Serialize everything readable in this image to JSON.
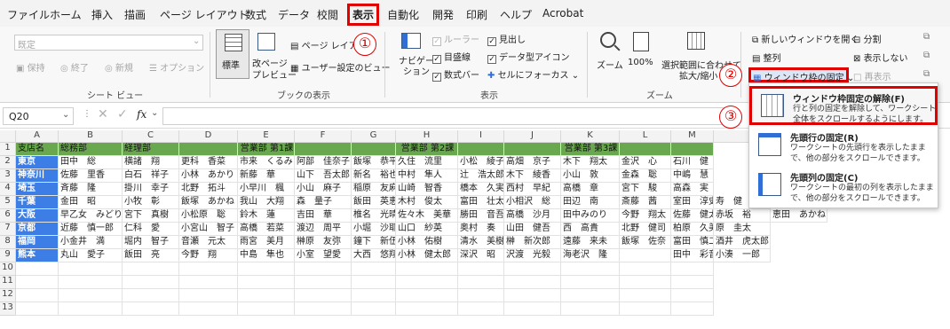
{
  "menu": [
    "ファイル",
    "ホーム",
    "挿入",
    "描画",
    "ページ レイアウト",
    "数式",
    "データ",
    "校閲",
    "表示",
    "自動化",
    "開発",
    "印刷",
    "ヘルプ",
    "Acrobat"
  ],
  "ribbon": {
    "sheet_view": {
      "select_placeholder": "既定",
      "keep": "保持",
      "exit": "終了",
      "new": "新規",
      "options": "オプション",
      "label": "シート ビュー"
    },
    "workbook_views": {
      "normal": "標準",
      "page_break": "改ページ",
      "page_break2": "プレビュー",
      "page_layout": "ページ レイアウト",
      "custom": "ユーザー設定のビュー",
      "label": "ブックの表示"
    },
    "show": {
      "navigation": "ナビゲー",
      "navigation2": "ション",
      "ruler": "ルーラー",
      "gridlines": "目盛線",
      "formula_bar": "数式バー",
      "headings": "見出し",
      "data_icons": "データ型アイコン",
      "focus_cell": "セルにフォーカス",
      "label": "表示"
    },
    "zoom": {
      "zoom": "ズーム",
      "hundred": "100%",
      "selection": "選択範囲に合わせて",
      "selection2": "拡大/縮小",
      "label": "ズーム"
    },
    "window": {
      "new_window": "新しいウィンドウを開く",
      "arrange": "整列",
      "freeze": "ウィンドウ枠の固定",
      "split": "分割",
      "hide": "表示しない",
      "unhide": "再表示"
    }
  },
  "callouts": [
    "①",
    "②",
    "③"
  ],
  "formula_bar": {
    "name_box": "Q20",
    "fx": "fx"
  },
  "columns": [
    "A",
    "B",
    "C",
    "D",
    "E",
    "F",
    "G",
    "H",
    "I",
    "J",
    "K",
    "L",
    "M"
  ],
  "rows": [
    "1",
    "2",
    "3",
    "4",
    "5",
    "6",
    "7",
    "8",
    "9",
    "10",
    "11",
    "12",
    "13"
  ],
  "grid": {
    "header": [
      "支店名",
      "総務部",
      "経理部",
      "",
      "営業部 第1課",
      "",
      "",
      "営業部 第2課",
      "",
      "",
      "営業部 第3課",
      "",
      ""
    ],
    "data": [
      [
        "東京",
        "田中　総",
        "横諸　翔",
        "更科　香菜",
        "市来　くるみ",
        "阿部　佳奈子",
        "飯塚　恭平",
        "久住　流里",
        "小松　綾子",
        "高畑　京子",
        "木下　翔太",
        "金沢　心",
        "石川　健"
      ],
      [
        "神奈川",
        "佐藤　里香",
        "白石　祥子",
        "小林　あかり",
        "新藤　華",
        "山下　吾太郎",
        "新名　裕也",
        "中村　隼人",
        "辻　浩太郎",
        "木下　綾香",
        "小山　敦",
        "金森　聡",
        "中嶋　慧"
      ],
      [
        "埼玉",
        "斉藤　隆",
        "掛川　幸子",
        "北野　拓斗",
        "小早川　楓",
        "小山　麻子",
        "稲原　友麻",
        "山崎　智香",
        "橋本　久実",
        "西村　早紀",
        "高橋　章",
        "宮下　駿",
        "高森　実"
      ],
      [
        "千葉",
        "金田　昭",
        "小牧　彰",
        "飯塚　あかね",
        "我山　大翔",
        "森　量子",
        "飯田　英恵",
        "木村　俊太",
        "富田　壮太",
        "小相沢　総",
        "田辺　南",
        "斎藤　茜",
        "室田　淳史"
      ],
      [
        "大阪",
        "早乙女　みどり",
        "宮下　真樹",
        "小松原　聡",
        "鈴木　蓮",
        "吉田　華",
        "椎名　光晴",
        "佐々木　美華",
        "勝田　音吾",
        "高橋　沙月",
        "田中みのり",
        "今野　翔太",
        "佐藤　健太"
      ],
      [
        "京都",
        "近藤　慎一郎",
        "仁科　愛",
        "小宮山　智子",
        "高橋　若菜",
        "渡辺　周平",
        "小堀　沙耶",
        "山口　紗英",
        "奥村　奏",
        "山田　健吾",
        "西　高貴",
        "北野　健司",
        "柏原　久美子"
      ],
      [
        "福岡",
        "小金井　満",
        "堀内　智子",
        "音瀬　元太",
        "雨宮　美月",
        "榊原　友弥",
        "鐘下　新伍",
        "小林　佑樹",
        "清水　美樹",
        "榊　新次郎",
        "遠藤　来未",
        "飯塚　佐奈",
        "富田　慎二"
      ],
      [
        "熊本",
        "丸山　愛子",
        "飯田　亮",
        "今野　翔",
        "中島　隼也",
        "小室　望愛",
        "大西　悠翔",
        "小林　健太郎",
        "深沢　昭",
        "沢渡　光毅",
        "海老沢　隆",
        "",
        "田中　彩音"
      ]
    ],
    "overflow": [
      {
        "text": "寿　健",
        "row": 5,
        "col": 13
      },
      {
        "text": "恵田　あかね",
        "row": 6,
        "col": 14
      },
      {
        "text": "赤坂　裕",
        "row": 6,
        "col": 13
      },
      {
        "text": "原　圭太",
        "row": 7,
        "col": 13
      },
      {
        "text": "酒井　虎太郎",
        "row": 8,
        "col": 13
      },
      {
        "text": "小湊　一郎",
        "row": 9,
        "col": 13
      }
    ]
  },
  "dropdown": {
    "items": [
      {
        "title": "ウィンドウ枠固定の解除(F)",
        "desc": "行と列の固定を解除して、ワークシート全体をスクロールするようにします。"
      },
      {
        "title": "先頭行の固定(R)",
        "desc": "ワークシートの先頭行を表示したまま で、他の部分をスクロールできます。"
      },
      {
        "title": "先頭列の固定(C)",
        "desc": "ワークシートの最初の列を表示したまま で、他の部分をスクロールできます。"
      }
    ]
  },
  "colors": {
    "header_green": "#6aa84f",
    "branch_blue": "#3d7ee6",
    "highlight_red": "#e00000"
  }
}
